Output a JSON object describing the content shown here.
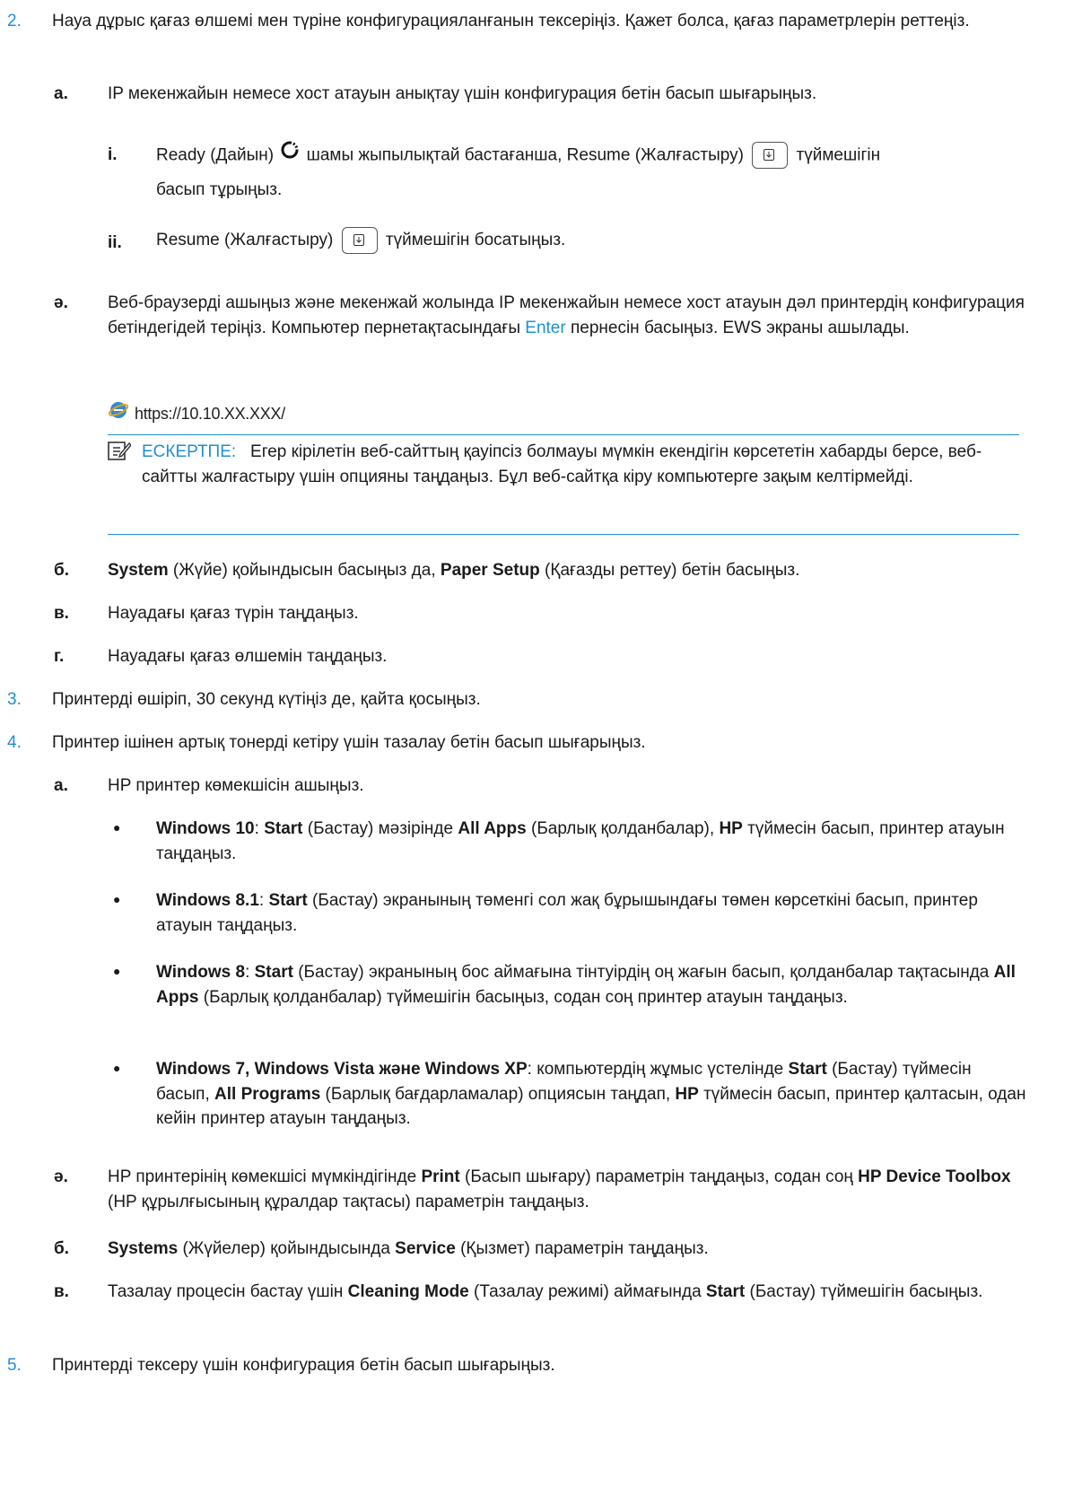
{
  "step2": {
    "num": "2.",
    "text": "Науа дұрыс қағаз өлшемі мен түріне конфигурацияланғанын тексеріңіз. Қажет болса, қағаз параметрлерін реттеңіз.",
    "a": {
      "num": "a.",
      "text": "IP мекенжайын немесе хост атауын анықтау үшін конфигурация бетін басып шығарыңыз.",
      "i": {
        "num": "i.",
        "before": "Ready (Дайын)",
        "mid": "шамы жыпылықтай бастағанша, Resume (Жалғастыру)",
        "after": "түймешігін",
        "line2": "басып тұрыңыз."
      },
      "ii": {
        "num": "ii.",
        "before": "Resume (Жалғастыру)",
        "after": "түймешігін босатыңыз."
      }
    },
    "ae": {
      "num": "ə.",
      "text_before": "Веб-браузерді ашыңыз және мекенжай жолында IP мекенжайын немесе хост атауын дәл принтердің конфигурация бетіндегідей теріңіз. Компьютер пернетақтасындағы",
      "link": "Enter",
      "text_after": "пернесін басыңыз. EWS экраны ашылады."
    },
    "url": "https://10.10.XX.XXX/",
    "note": {
      "label": "ЕСКЕРТПЕ:",
      "text": "Егер кірілетін веб-сайттың қауіпсіз болмауы мүмкін екендігін көрсететін хабарды берсе, веб-сайтты жалғастыру үшін опцияны таңдаңыз. Бұл веб-сайтқа кіру компьютерге зақым келтірмейді."
    },
    "b": {
      "num": "б.",
      "bold1": "System",
      "t1": "(Жүйе) қойындысын басыңыз да,",
      "bold2": "Paper Setup",
      "t2": "(Қағазды реттеу) бетін басыңыз."
    },
    "v": {
      "num": "в.",
      "text": "Науадағы қағаз түрін таңдаңыз."
    },
    "g": {
      "num": "г.",
      "text": "Науадағы қағаз өлшемін таңдаңыз."
    }
  },
  "step3": {
    "num": "3.",
    "text": "Принтерді өшіріп, 30 секунд күтіңіз де, қайта қосыңыз."
  },
  "step4": {
    "num": "4.",
    "text": "Принтер ішінен артық тонерді кетіру үшін тазалау бетін басып шығарыңыз.",
    "a": {
      "num": "a.",
      "text": "HP принтер көмекшісін ашыңыз.",
      "bullets": [
        {
          "b1": "Windows 10",
          "t1": ": ",
          "b2": "Start",
          "t2": " (Бастау) мәзірінде ",
          "b3": "All Apps",
          "t3": " (Барлық қолданбалар), ",
          "b4": "HP",
          "t4": " түймесін басып, принтер атауын таңдаңыз."
        },
        {
          "b1": "Windows 8.1",
          "t1": ": ",
          "b2": "Start",
          "t2": " (Бастау) экранының төменгі сол жақ бұрышындағы төмен көрсеткіні басып, принтер атауын таңдаңыз."
        },
        {
          "b1": "Windows 8",
          "t1": ": ",
          "b2": "Start",
          "t2": " (Бастау) экранының бос аймағына тінтуірдің оң жағын басып, қолданбалар тақтасында ",
          "b3": "All Apps",
          "t3": " (Барлық қолданбалар) түймешігін басыңыз, содан соң принтер атауын таңдаңыз."
        },
        {
          "b1": "Windows 7, Windows Vista және Windows XP",
          "t1": ": компьютердің жұмыс үстелінде ",
          "b2": "Start",
          "t2": " (Бастау) түймесін басып, ",
          "b3": "All Programs",
          "t3": " (Барлық бағдарламалар) опциясын таңдап, ",
          "b4": "HP",
          "t4": " түймесін басып, принтер қалтасын, одан кейін принтер атауын таңдаңыз."
        }
      ]
    },
    "ae": {
      "num": "ə.",
      "t1": "HP принтерінің көмекшісі мүмкіндігінде ",
      "b1": "Print",
      "t2": " (Басып шығару) параметрін таңдаңыз, содан соң ",
      "b2": "HP Device Toolbox",
      "t3": " (HP құрылғысының құралдар тақтасы) параметрін таңдаңыз."
    },
    "b": {
      "num": "б.",
      "b1": "Systems",
      "t1": " (Жүйелер) қойындысында ",
      "b2": "Service",
      "t2": " (Қызмет) параметрін таңдаңыз."
    },
    "v": {
      "num": "в.",
      "t1": "Тазалау процесін бастау үшін ",
      "b1": "Cleaning Mode",
      "t2": " (Тазалау режимі) аймағында ",
      "b2": "Start",
      "t3": " (Бастау) түймешігін басыңыз."
    }
  },
  "step5": {
    "num": "5.",
    "text": "Принтерді тексеру үшін конфигурация бетін басып шығарыңыз."
  }
}
